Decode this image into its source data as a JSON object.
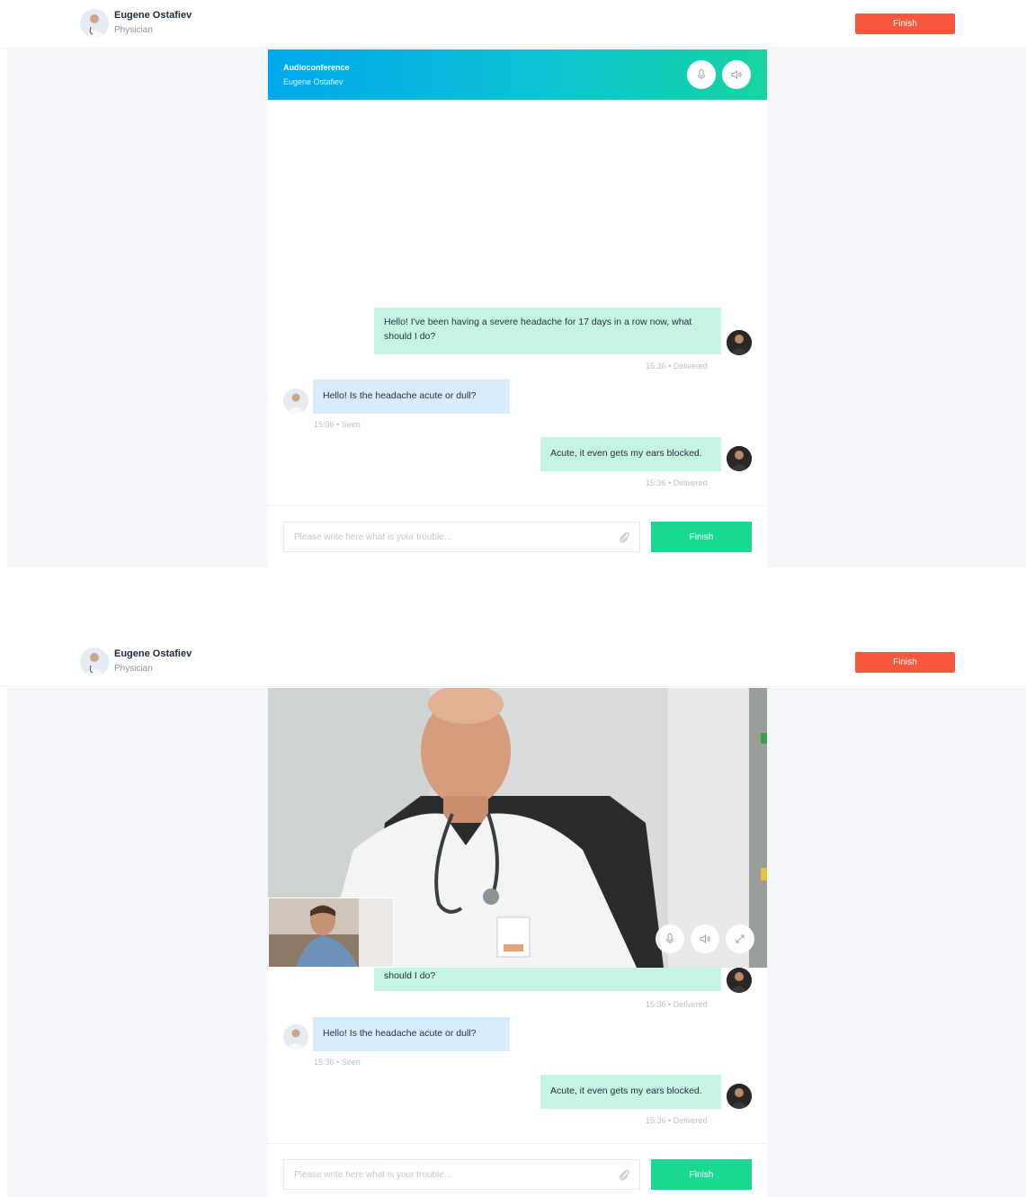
{
  "header": {
    "doctor_name": "Eugene Ostafiev",
    "doctor_role": "Physician",
    "finish_label": "Finish"
  },
  "call": {
    "title": "Audioconference",
    "subtitle": "Eugene Ostafiev"
  },
  "messages": [
    {
      "direction": "out",
      "text": "Hello! I've been having a severe headache for 17 days in a row now, what should I do?",
      "tail_text": "should I do?",
      "time": "15:36",
      "status": "Delivered"
    },
    {
      "direction": "in",
      "text": "Hello! Is the headache acute or dull?",
      "time": "15:36",
      "status": "Seen"
    },
    {
      "direction": "out",
      "text": "Acute, it even gets my ears blocked.",
      "time": "15:36",
      "status": "Delivered"
    }
  ],
  "meta_separator": "•",
  "composer": {
    "placeholder": "Please write here what is your trouble...",
    "send_label": "Finish"
  },
  "icons": {
    "mic": "microphone-icon",
    "speaker": "speaker-icon",
    "expand": "expand-icon",
    "attach": "paperclip-icon"
  },
  "colors": {
    "finish": "#f9573c",
    "send": "#18d98f",
    "header_gradient_start": "#00a8ef",
    "header_gradient_end": "#16d5a1",
    "outgoing_bubble": "#c5f4e2",
    "incoming_bubble": "#d9ecfb"
  }
}
